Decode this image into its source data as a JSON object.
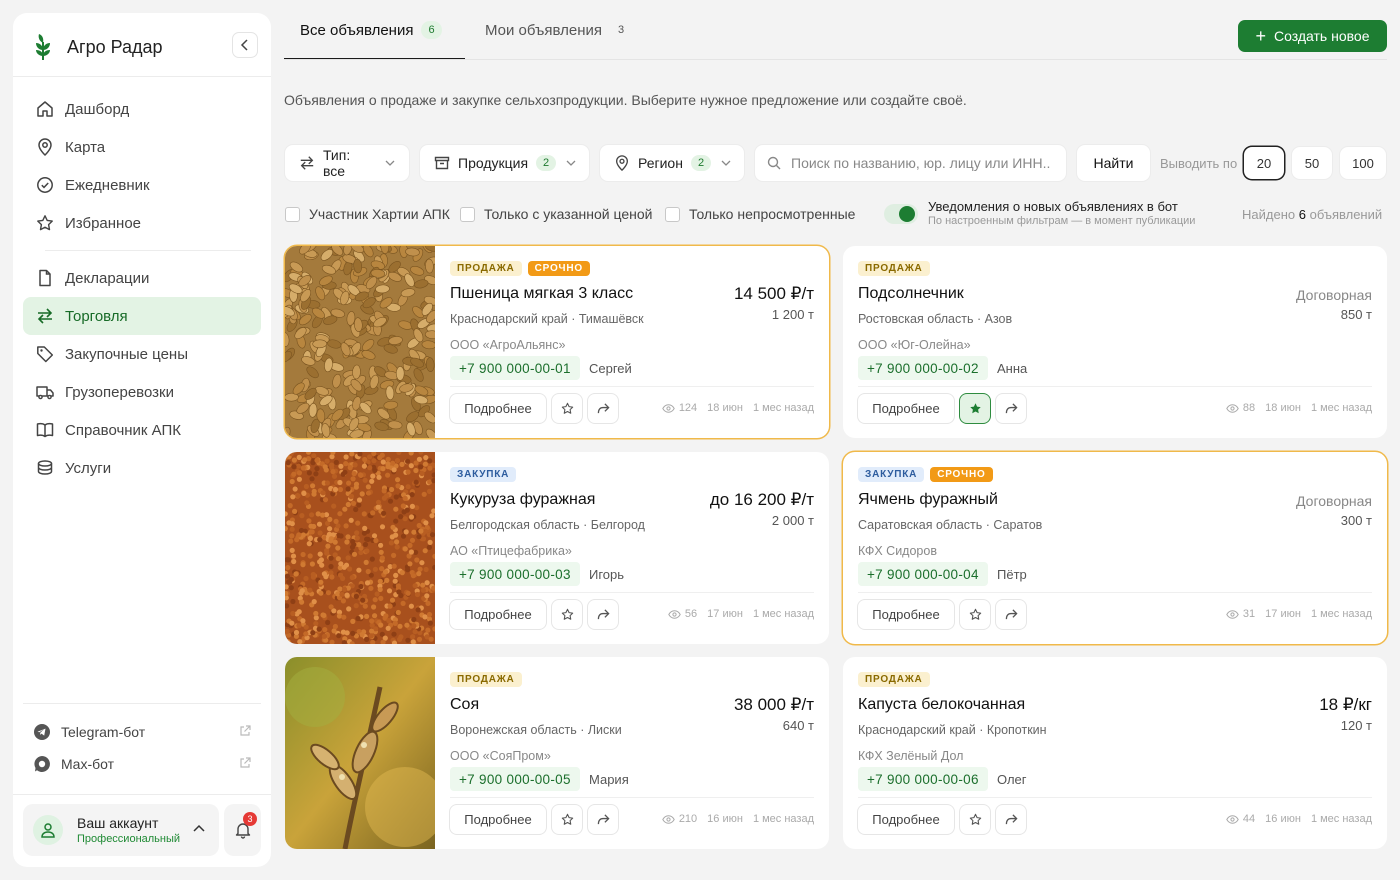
{
  "app": {
    "name": "Агро Радар"
  },
  "sidebar": {
    "groups": [
      [
        {
          "label": "Дашборд",
          "icon": "home-icon"
        },
        {
          "label": "Карта",
          "icon": "map-pin-icon"
        },
        {
          "label": "Ежедневник",
          "icon": "check-circle-icon"
        },
        {
          "label": "Избранное",
          "icon": "star-icon"
        }
      ],
      [
        {
          "label": "Декларации",
          "icon": "document-icon"
        },
        {
          "label": "Торговля",
          "icon": "arrows-swap-icon",
          "active": true
        },
        {
          "label": "Закупочные цены",
          "icon": "tag-icon"
        },
        {
          "label": "Грузоперевозки",
          "icon": "truck-icon"
        },
        {
          "label": "Справочник АПК",
          "icon": "book-icon"
        },
        {
          "label": "Услуги",
          "icon": "stack-icon"
        }
      ]
    ],
    "bots": [
      {
        "label": "Telegram-бот"
      },
      {
        "label": "Max-бот"
      }
    ],
    "account": {
      "name": "Ваш аккаунт",
      "plan": "Профессиональный",
      "notifications": "3"
    }
  },
  "tabs": [
    {
      "label": "Все объявления",
      "count": "6",
      "active": true
    },
    {
      "label": "Мои объявления",
      "count": "3"
    }
  ],
  "create_button": "Создать новое",
  "subtitle": "Объявления о продаже и закупке сельхозпродукции. Выберите нужное предложение или создайте своё.",
  "filters": {
    "type": "Тип: все",
    "product": {
      "label": "Продукция",
      "count": "2"
    },
    "region": {
      "label": "Регион",
      "count": "2"
    },
    "search_placeholder": "Поиск по названию, юр. лицу или ИНН..",
    "find": "Найти",
    "per_page_label": "Выводить по",
    "per_page_options": [
      "20",
      "50",
      "100"
    ],
    "per_page_selected": "20",
    "checkboxes": [
      "Участник Хартии АПК",
      "Только с указанной ценой",
      "Только непросмотренные"
    ],
    "notify_title": "Уведомления о новых объявлениях в бот",
    "notify_sub": "По настроенным фильтрам — в момент публикации",
    "notify_on": true,
    "found_prefix": "Найдено",
    "found_count": "6",
    "found_suffix": "объявлений"
  },
  "listing_labels": {
    "more": "Подробнее"
  },
  "listings": [
    {
      "tags": [
        "ПРОДАЖА",
        "СРОЧНО"
      ],
      "kind": "sale",
      "urgent": true,
      "title": "Пшеница мягкая 3 класс",
      "location": "Краснодарский край · Тимашёвск",
      "price": "14 500 ₽/т",
      "volume": "1 200 т",
      "company": "ООО «АгроАльянс»",
      "phone": "+7 900 000-00-01",
      "person": "Сергей",
      "views": "124",
      "date": "18 июн",
      "ago": "1 мес назад",
      "image": "wheat",
      "favorite": false
    },
    {
      "tags": [
        "ПРОДАЖА"
      ],
      "kind": "sale",
      "urgent": false,
      "title": "Подсолнечник",
      "location": "Ростовская область · Азов",
      "price": "Договорная",
      "negotiable": true,
      "volume": "850 т",
      "company": "ООО «Юг-Олейна»",
      "phone": "+7 900 000-00-02",
      "person": "Анна",
      "views": "88",
      "date": "18 июн",
      "ago": "1 мес назад",
      "favorite": true
    },
    {
      "tags": [
        "ЗАКУПКА"
      ],
      "kind": "buy",
      "urgent": false,
      "title": "Кукуруза фуражная",
      "location": "Белгородская область · Белгород",
      "price": "до 16 200 ₽/т",
      "volume": "2 000 т",
      "company": "АО «Птицефабрика»",
      "phone": "+7 900 000-00-03",
      "person": "Игорь",
      "views": "56",
      "date": "17 июн",
      "ago": "1 мес назад",
      "image": "millet",
      "favorite": false
    },
    {
      "tags": [
        "ЗАКУПКА",
        "СРОЧНО"
      ],
      "kind": "buy",
      "urgent": true,
      "title": "Ячмень фуражный",
      "location": "Саратовская область · Саратов",
      "price": "Договорная",
      "negotiable": true,
      "volume": "300 т",
      "company": "КФХ Сидоров",
      "phone": "+7 900 000-00-04",
      "person": "Пётр",
      "views": "31",
      "date": "17 июн",
      "ago": "1 мес назад",
      "favorite": false
    },
    {
      "tags": [
        "ПРОДАЖА"
      ],
      "kind": "sale",
      "urgent": false,
      "title": "Соя",
      "location": "Воронежская область · Лиски",
      "price": "38 000 ₽/т",
      "volume": "640 т",
      "company": "ООО «СояПром»",
      "phone": "+7 900 000-00-05",
      "person": "Мария",
      "views": "210",
      "date": "16 июн",
      "ago": "1 мес назад",
      "image": "soy",
      "favorite": false
    },
    {
      "tags": [
        "ПРОДАЖА"
      ],
      "kind": "sale",
      "urgent": false,
      "title": "Капуста белокочанная",
      "location": "Краснодарский край · Кропоткин",
      "price": "18 ₽/кг",
      "volume": "120 т",
      "company": "КФХ Зелёный Дол",
      "phone": "+7 900 000-00-06",
      "person": "Олег",
      "views": "44",
      "date": "16 июн",
      "ago": "1 мес назад",
      "favorite": false
    }
  ],
  "colors": {
    "accent": "#1d7d32",
    "accent_light": "#e3f3e4",
    "urgent": "#f29a16",
    "bg": "#f3f3f3"
  }
}
